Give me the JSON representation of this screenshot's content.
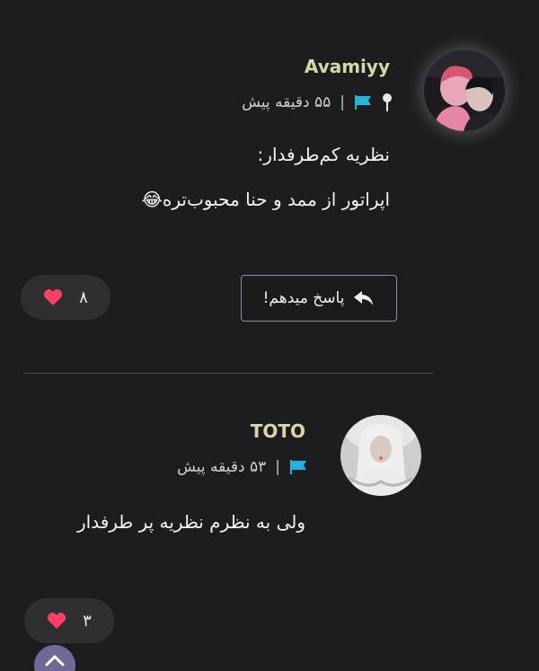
{
  "comments": [
    {
      "username": "Avamiyy",
      "time": "۵۵ دقیقه پیش",
      "separator": "|",
      "pinned": true,
      "flag_icon": "flag-icon",
      "lines": [
        "نظریه کم‌طرفدار:",
        "اپراتور از ممد و حنا محبوب‌تره😂"
      ],
      "reply_label": "پاسخ میدهم!",
      "likes": "۸"
    },
    {
      "username": "TOTO",
      "time": "۵۳ دقیقه پیش",
      "separator": "|",
      "pinned": false,
      "flag_icon": "flag-icon",
      "lines": [
        "ولی به نظرم نظریه پر طرفدار"
      ],
      "likes": "۳"
    }
  ],
  "colors": {
    "background": "#1d1d1f",
    "username": "#d9d7a8",
    "flag": "#21b6d9",
    "heart": "#ff3f63",
    "scroll_button": "#6e6a95"
  }
}
